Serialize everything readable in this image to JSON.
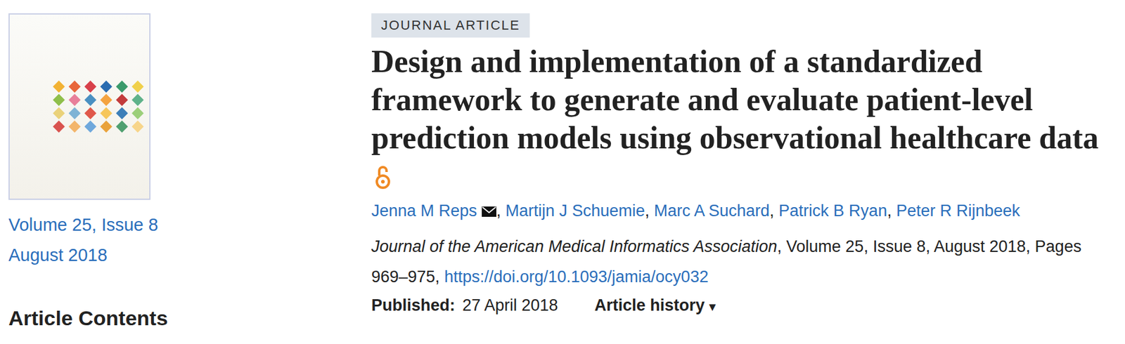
{
  "sidebar": {
    "issue": "Volume 25, Issue 8",
    "date": "August 2018",
    "contents_heading": "Article Contents"
  },
  "article": {
    "type_badge": "JOURNAL ARTICLE",
    "title": "Design and implementation of a standardized framework to generate and evaluate patient-level prediction models using observational healthcare data",
    "open_access": true,
    "authors": [
      {
        "name": "Jenna M Reps",
        "corresponding": true,
        "separator": ", "
      },
      {
        "name": "Martijn J Schuemie",
        "corresponding": false,
        "separator": ", "
      },
      {
        "name": "Marc A Suchard",
        "corresponding": false,
        "separator": ", "
      },
      {
        "name": "Patrick B Ryan",
        "corresponding": false,
        "separator": ", "
      },
      {
        "name": "Peter R Rijnbeek",
        "corresponding": false,
        "separator": ""
      }
    ],
    "citation": {
      "journal": "Journal of the American Medical Informatics Association",
      "details": ", Volume 25, Issue 8, August 2018, Pages 969–975, ",
      "doi": "https://doi.org/10.1093/jamia/ocy032"
    },
    "published_label": "Published:",
    "published_date": "27 April 2018",
    "history_label": "Article history",
    "history_icon": "▾"
  }
}
